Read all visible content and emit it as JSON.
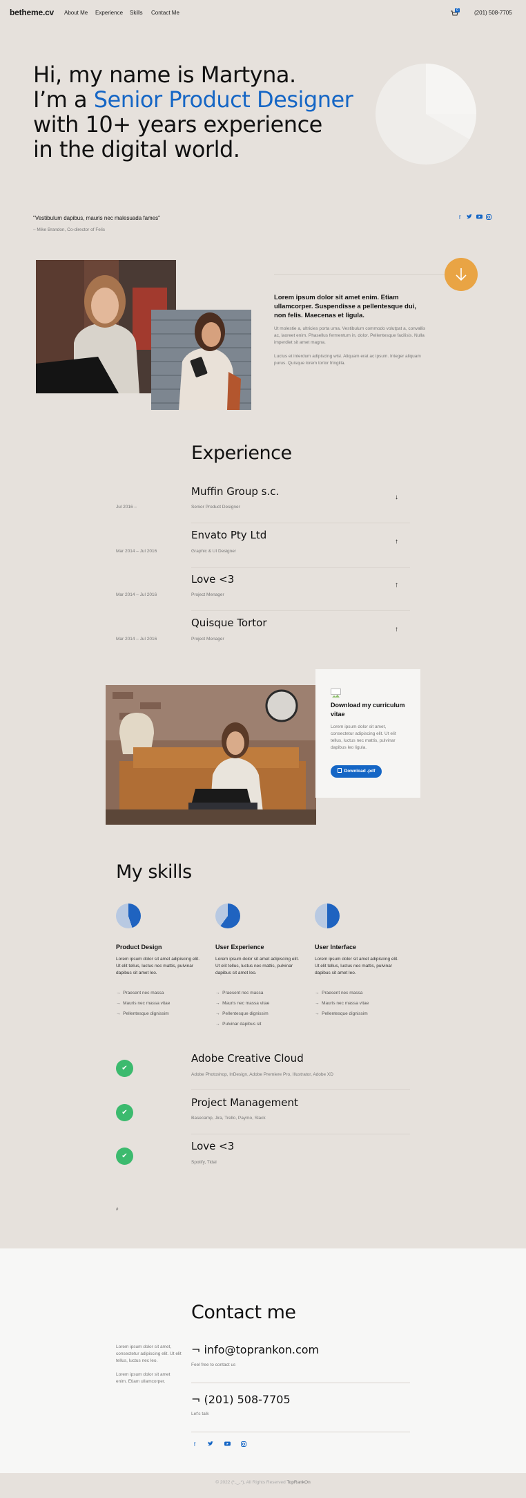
{
  "nav": {
    "logo": "betheme.cv",
    "links": [
      "About Me",
      "Experience",
      "Skills",
      "Contact Me"
    ],
    "cart_count": "0",
    "phone": "(201) 508-7705"
  },
  "hero": {
    "line1": "Hi, my name is Martyna.",
    "line2_prefix": "I’m a ",
    "line2_highlight": "Senior Product Designer",
    "line3": "with 10+ years experience",
    "line4": "in the digital world.",
    "highlight_color": "#1566c5"
  },
  "quote": {
    "text": "\"Vestibulum dapibus, mauris nec malesuada fames\"",
    "author": "– Mike Brandon, Co-director of Felis"
  },
  "social_icons": [
    "facebook-icon",
    "twitter-icon",
    "youtube-icon",
    "instagram-icon"
  ],
  "about": {
    "heading": "Lorem ipsum dolor sit amet enim. Etiam ullamcorper. Suspendisse a pellentesque dui, non felis. Maecenas et ligula.",
    "p1": "Ut molestie a, ultricies porta urna. Vestibulum commodo volutpat a, convallis ac, laoreet enim. Phasellus fermentum in, dolor. Pellentesque facilisis. Nulla imperdiet sit amet magna.",
    "p2": "Luctus et interdum adipiscing wisi. Aliquam erat ac ipsum. Integer aliquam purus. Quisque lorem tortor fringilla."
  },
  "experience": {
    "title": "Experience",
    "items": [
      {
        "company": "Muffin Group s.c.",
        "role": "Senior Product Designer",
        "date": "Jul 2016 –",
        "arrow": "↓"
      },
      {
        "company": "Envato Pty Ltd",
        "role": "Graphic & UI Designer",
        "date": "Mar 2014 – Jul 2016",
        "arrow": "↑"
      },
      {
        "company": "Love <3",
        "role": "Project Menager",
        "date": "Mar 2014 – Jul 2016",
        "arrow": "↑"
      },
      {
        "company": "Quisque Tortor",
        "role": "Project Menager",
        "date": "Mar 2014 – Jul 2016",
        "arrow": "↑"
      }
    ]
  },
  "cv": {
    "title": "Download my curriculum vitae",
    "text": "Lorem ipsum dolor sit amet, consectetur adipiscing elit. Ut elit tellus, luctus nec mattis, pulvinar dapibus leo ligula.",
    "button": "Download .pdf"
  },
  "skills": {
    "title": "My skills",
    "items": [
      {
        "name": "Product Design",
        "text": "Lorem ipsum dolor sit amet adipiscing elit. Ut elit tellus, luctus nec mattis, pulvinar dapibus sit amet leo.",
        "bullets": [
          "Praesent nec massa",
          "Mauris nec massa vitae",
          "Pellentesque dignissim"
        ],
        "level": 0.45
      },
      {
        "name": "User Experience",
        "text": "Lorem ipsum dolor sit amet adipiscing elit. Ut elit tellus, luctus nec mattis, pulvinar dapibus sit amet leo.",
        "bullets": [
          "Praesent nec massa",
          "Mauris nec massa vitae",
          "Pellentesque dignissim",
          "Pulvinar dapibus sit"
        ],
        "level": 0.6
      },
      {
        "name": "User Interface",
        "text": "Lorem ipsum dolor sit amet adipiscing elit. Ut elit tellus, luctus nec mattis, pulvinar dapibus sit amet leo.",
        "bullets": [
          "Praesent nec massa",
          "Mauris nec massa vitae",
          "Pellentesque dignissim"
        ],
        "level": 0.5
      }
    ]
  },
  "tools": [
    {
      "name": "Adobe Creative Cloud",
      "desc": "Adobe Photoshop, InDesign, Adobe Premiere Pro, Illustrator, Adobe XD"
    },
    {
      "name": "Project Management",
      "desc": "Basecamp, Jira, Trello, Paymo, Slack"
    },
    {
      "name": "Love <3",
      "desc": "Spotify, Tidal"
    }
  ],
  "small_mark": "#",
  "contact": {
    "title": "Contact me",
    "left_p1": "Lorem ipsum dolor sit amet, consectetur adipiscing elit. Ut elit tellus, luctus nec leo.",
    "left_p2": "Lorem ipsum dolor sit amet enim. Etiam ullamcorper.",
    "email": "¬ info@toprankon.com",
    "email_sub": "Feel free to contact us",
    "phone": "¬ (201) 508-7705",
    "phone_sub": "Let's talk"
  },
  "footer": {
    "text": "© 2022 (*,‿,*), All Rights Reserved ",
    "brand": "TopRankOn"
  },
  "colors": {
    "accent": "#1566c5",
    "orange": "#e9a444",
    "green": "#3cba6e",
    "background": "#e6e1dc"
  }
}
